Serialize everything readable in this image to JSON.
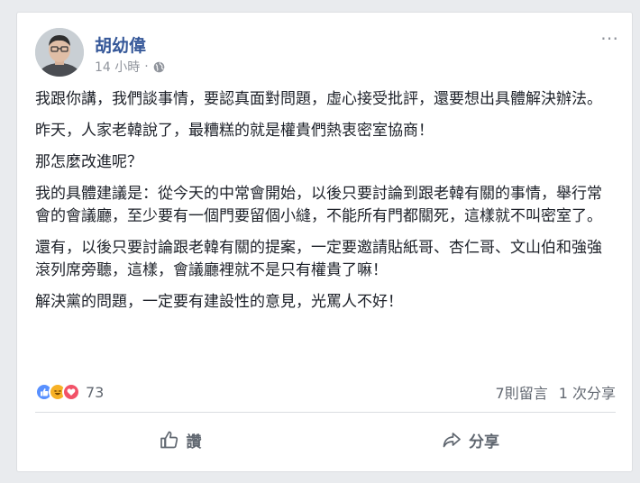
{
  "post": {
    "author": "胡幼偉",
    "time": "14 小時",
    "separator": "·",
    "paragraphs": [
      "我跟你講，我們談事情，要認真面對問題，虛心接受批評，還要想出具體解決辦法。",
      "昨天，人家老韓說了，最糟糕的就是權貴們熱衷密室協商！",
      "那怎麼改進呢？",
      "我的具體建議是：從今天的中常會開始，以後只要討論到跟老韓有關的事情，舉行常會的會議廳，至少要有一個門要留個小縫，不能所有門都關死，這樣就不叫密室了。",
      "還有，以後只要討論跟老韓有關的提案，一定要邀請貼紙哥、杏仁哥、文山伯和強強滾列席旁聽，這樣，會議廳裡就不是只有權貴了嘛！",
      "解決黨的問題，一定要有建設性的意見，光罵人不好！"
    ],
    "reaction_count": "73",
    "comments": "7則留言",
    "shares": "1 次分享",
    "more_icon": "⋯",
    "like_label": "讚",
    "share_label": "分享",
    "colors": {
      "author": "#365899",
      "like": "#5890ff",
      "haha": "#f7b125",
      "love": "#f25268"
    },
    "icons": [
      "avatar",
      "globe-icon",
      "more-options-icon",
      "like-reaction-icon",
      "haha-reaction-icon",
      "love-reaction-icon",
      "thumbs-up-icon",
      "share-arrow-icon"
    ]
  }
}
